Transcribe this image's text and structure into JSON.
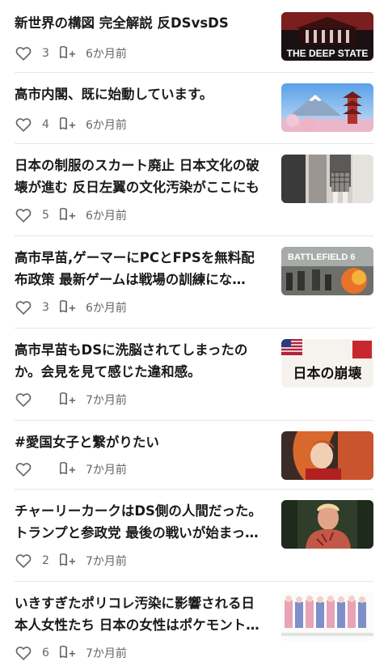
{
  "articles": [
    {
      "title": "新世界の構図 完全解説 反DSvsDS",
      "likes": "3",
      "time": "6か月前",
      "thumb_text": "THE DEEP STATE"
    },
    {
      "title": "高市内閣、既に始動しています。",
      "likes": "4",
      "time": "6か月前"
    },
    {
      "title": "日本の制服のスカート廃止 日本文化の破壊が進む 反日左翼の文化汚染がここにも",
      "likes": "5",
      "time": "6か月前"
    },
    {
      "title": "高市早苗,ゲーマーにPCとFPSを無料配布政策 最新ゲームは戦場の訓練にな…",
      "likes": "3",
      "time": "6か月前",
      "thumb_text": "BATTLEFIELD 6"
    },
    {
      "title": "高市早苗もDSに洗脳されてしまったのか。会見を見て感じた違和感。",
      "likes": "",
      "time": "7か月前",
      "thumb_text": "日本の崩壊"
    },
    {
      "title": "#愛国女子と繋がりたい",
      "likes": "",
      "time": "7か月前"
    },
    {
      "title": "チャーリーカークはDS側の人間だった。トランプと参政党 最後の戦いが始まっ…",
      "likes": "2",
      "time": "7か月前"
    },
    {
      "title": "いきすぎたポリコレ汚染に影響される日本人女性たち 日本の女性はポケモント…",
      "likes": "6",
      "time": "7か月前"
    }
  ]
}
